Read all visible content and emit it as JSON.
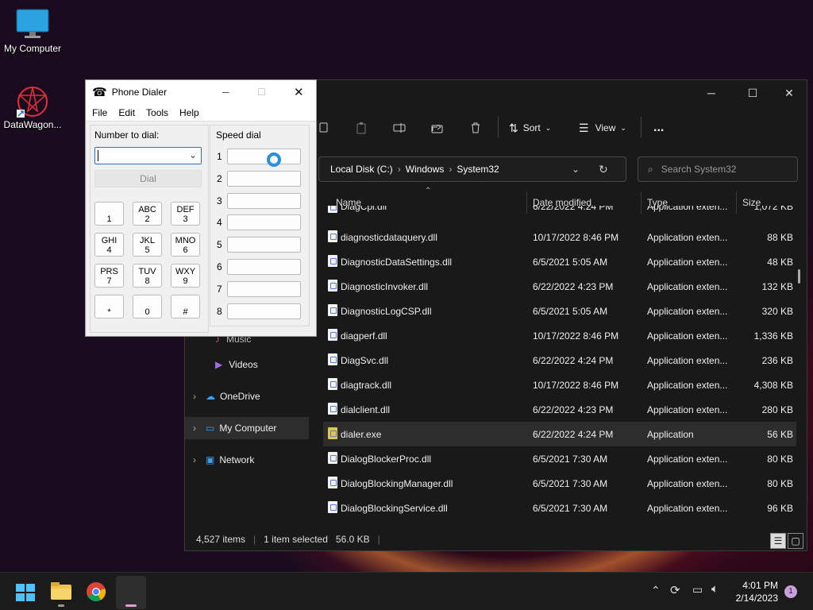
{
  "desktop": {
    "icons": [
      {
        "label": "My Computer"
      },
      {
        "label": "DataWagon..."
      }
    ]
  },
  "explorer": {
    "toolbar": {
      "sort": "Sort",
      "view": "View",
      "more": "..."
    },
    "address": {
      "crumbs": [
        "Local Disk (C:)",
        "Windows",
        "System32"
      ],
      "sep": "›"
    },
    "search": {
      "placeholder": "Search System32"
    },
    "columns": {
      "name": "Name",
      "date": "Date modified",
      "type": "Type",
      "size": "Size"
    },
    "nav": [
      {
        "label": "Music"
      },
      {
        "label": "Videos"
      },
      {
        "label": "OneDrive"
      },
      {
        "label": "My Computer"
      },
      {
        "label": "Network"
      }
    ],
    "rows": [
      {
        "name": "DiagCpl.dll",
        "date": "6/22/2022 4:24 PM",
        "type": "Application exten...",
        "size": "1,072 KB"
      },
      {
        "name": "diagnosticdataquery.dll",
        "date": "10/17/2022 8:46 PM",
        "type": "Application exten...",
        "size": "88 KB"
      },
      {
        "name": "DiagnosticDataSettings.dll",
        "date": "6/5/2021 5:05 AM",
        "type": "Application exten...",
        "size": "48 KB"
      },
      {
        "name": "DiagnosticInvoker.dll",
        "date": "6/22/2022 4:23 PM",
        "type": "Application exten...",
        "size": "132 KB"
      },
      {
        "name": "DiagnosticLogCSP.dll",
        "date": "6/5/2021 5:05 AM",
        "type": "Application exten...",
        "size": "320 KB"
      },
      {
        "name": "diagperf.dll",
        "date": "10/17/2022 8:46 PM",
        "type": "Application exten...",
        "size": "1,336 KB"
      },
      {
        "name": "DiagSvc.dll",
        "date": "6/22/2022 4:24 PM",
        "type": "Application exten...",
        "size": "236 KB"
      },
      {
        "name": "diagtrack.dll",
        "date": "10/17/2022 8:46 PM",
        "type": "Application exten...",
        "size": "4,308 KB"
      },
      {
        "name": "dialclient.dll",
        "date": "6/22/2022 4:23 PM",
        "type": "Application exten...",
        "size": "280 KB"
      },
      {
        "name": "dialer.exe",
        "date": "6/22/2022 4:24 PM",
        "type": "Application",
        "size": "56 KB"
      },
      {
        "name": "DialogBlockerProc.dll",
        "date": "6/5/2021 7:30 AM",
        "type": "Application exten...",
        "size": "80 KB"
      },
      {
        "name": "DialogBlockingManager.dll",
        "date": "6/5/2021 7:30 AM",
        "type": "Application exten...",
        "size": "80 KB"
      },
      {
        "name": "DialogBlockingService.dll",
        "date": "6/5/2021 7:30 AM",
        "type": "Application exten...",
        "size": "96 KB"
      }
    ],
    "status": {
      "items": "4,527 items",
      "selected": "1 item selected",
      "selsize": "56.0 KB"
    }
  },
  "dialer": {
    "title": "Phone Dialer",
    "menu": [
      "File",
      "Edit",
      "Tools",
      "Help"
    ],
    "number_label": "Number to dial:",
    "dial": "Dial",
    "speed_label": "Speed dial",
    "keys": [
      {
        "top": "",
        "bottom": "1"
      },
      {
        "top": "ABC",
        "bottom": "2"
      },
      {
        "top": "DEF",
        "bottom": "3"
      },
      {
        "top": "GHI",
        "bottom": "4"
      },
      {
        "top": "JKL",
        "bottom": "5"
      },
      {
        "top": "MNO",
        "bottom": "6"
      },
      {
        "top": "PRS",
        "bottom": "7"
      },
      {
        "top": "TUV",
        "bottom": "8"
      },
      {
        "top": "WXY",
        "bottom": "9"
      },
      {
        "top": "",
        "bottom": "*"
      },
      {
        "top": "",
        "bottom": "0"
      },
      {
        "top": "",
        "bottom": "#"
      }
    ],
    "speed": [
      "1",
      "2",
      "3",
      "4",
      "5",
      "6",
      "7",
      "8"
    ]
  },
  "taskbar": {
    "time": "4:01 PM",
    "date": "2/14/2023",
    "badge": "1"
  }
}
